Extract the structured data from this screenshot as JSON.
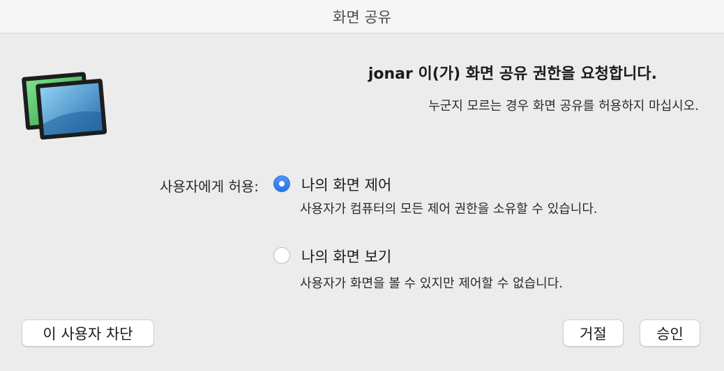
{
  "window": {
    "title": "화면 공유"
  },
  "request": {
    "heading": "jonar 이(가) 화면 공유 권한을 요청합니다.",
    "warning": "누군지 모르는 경우 화면 공유를 허용하지 마십시오."
  },
  "permissions": {
    "label": "사용자에게 허용:",
    "options": [
      {
        "label": "나의 화면 제어",
        "description": "사용자가 컴퓨터의 모든 제어 권한을 소유할 수 있습니다.",
        "selected": true
      },
      {
        "label": "나의 화면 보기",
        "description": "사용자가 화면을 볼 수 있지만 제어할 수 없습니다.",
        "selected": false
      }
    ]
  },
  "buttons": {
    "block": "이 사용자 차단",
    "decline": "거절",
    "accept": "승인"
  },
  "icons": {
    "app": "screen-sharing-app-icon"
  },
  "colors": {
    "accent": "#2b73e8"
  }
}
